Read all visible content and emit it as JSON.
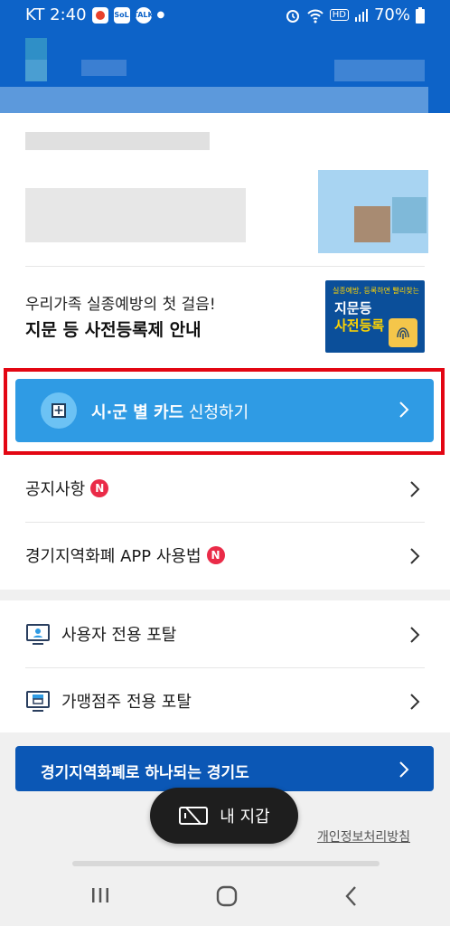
{
  "status_bar": {
    "carrier_time": "KT 2:40",
    "battery_percent": "70%",
    "notification_icons": [
      "app-icon",
      "sol-icon",
      "talk-icon"
    ],
    "sol_label": "SoL",
    "talk_label": "TALK",
    "system_icons": [
      "alarm-icon",
      "wifi-icon",
      "hd-icon",
      "signal-icon",
      "battery-icon"
    ],
    "hd_label": "HD"
  },
  "promo": {
    "subtitle": "우리가족 실종예방의 첫 걸음!",
    "title": "지문 등 사전등록제 안내",
    "thumb_line1": "실종예방, 등록하면 빨리찾는",
    "thumb_line2": "지문등",
    "thumb_line3": "사전등록"
  },
  "cta": {
    "label_bold": "시·군 별 카드",
    "label_rest": "신청하기"
  },
  "list": [
    {
      "label": "공지사항",
      "badge": "N"
    },
    {
      "label": "경기지역화폐 APP 사용법",
      "badge": "N"
    }
  ],
  "portals": [
    {
      "label": "사용자 전용 포탈",
      "icon": "user-monitor-icon"
    },
    {
      "label": "가맹점주 전용 포탈",
      "icon": "merchant-monitor-icon"
    }
  ],
  "banner": {
    "label": "경기지역화폐로 하나되는 경기도"
  },
  "wallet": {
    "label": "내 지갑",
    "icon": "wallet-icon"
  },
  "footer": {
    "privacy_link": "개인정보처리방침"
  },
  "nav": {
    "icons": [
      "recent-apps-icon",
      "home-icon",
      "back-icon"
    ]
  },
  "colors": {
    "header": "#0d63c8",
    "cta": "#2f9be4",
    "highlight": "#e30613",
    "banner": "#0b57b5",
    "badge": "#ea2b48"
  }
}
